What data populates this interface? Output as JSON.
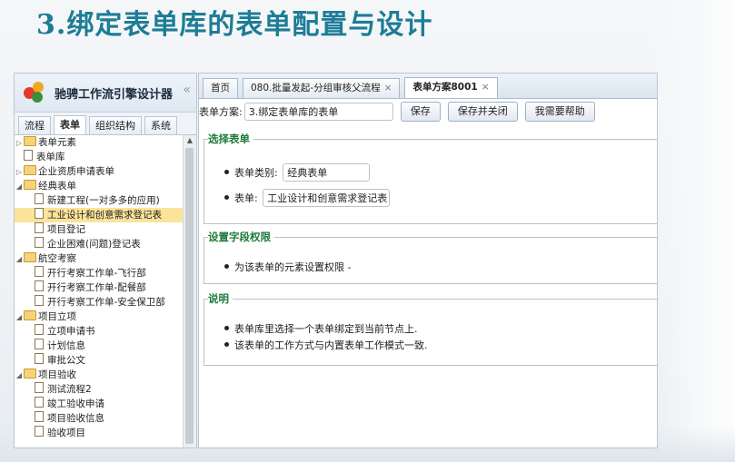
{
  "slide_title": "3.绑定表单库的表单配置与设计",
  "app": {
    "name": "驰骋工作流引擎设计器",
    "collapse_glyph": "«"
  },
  "left_tabs": [
    "流程",
    "表单",
    "组织结构",
    "系统"
  ],
  "tree": [
    {
      "label": "表单元素",
      "type": "folder",
      "level": 0,
      "expand": "▷"
    },
    {
      "label": "表单库",
      "type": "doc",
      "level": 0
    },
    {
      "label": "企业资质申请表单",
      "type": "folder",
      "level": 0,
      "expand": "▷"
    },
    {
      "label": "经典表单",
      "type": "folder",
      "level": 0,
      "expand": "◢"
    },
    {
      "label": "新建工程(一对多多的应用)",
      "type": "doc",
      "level": 1
    },
    {
      "label": "工业设计和创意需求登记表",
      "type": "doc",
      "level": 1,
      "selected": true
    },
    {
      "label": "项目登记",
      "type": "doc",
      "level": 1
    },
    {
      "label": "企业困难(问题)登记表",
      "type": "doc",
      "level": 1
    },
    {
      "label": "航空考察",
      "type": "folder",
      "level": 0,
      "expand": "◢"
    },
    {
      "label": "开行考察工作单-飞行部",
      "type": "doc",
      "level": 1
    },
    {
      "label": "开行考察工作单-配餐部",
      "type": "doc",
      "level": 1
    },
    {
      "label": "开行考察工作单-安全保卫部",
      "type": "doc",
      "level": 1
    },
    {
      "label": "项目立项",
      "type": "folder",
      "level": 0,
      "expand": "◢"
    },
    {
      "label": "立项申请书",
      "type": "doc",
      "level": 1
    },
    {
      "label": "计划信息",
      "type": "doc",
      "level": 1
    },
    {
      "label": "审批公文",
      "type": "doc",
      "level": 1
    },
    {
      "label": "项目验收",
      "type": "folder",
      "level": 0,
      "expand": "◢"
    },
    {
      "label": "测试流程2",
      "type": "doc",
      "level": 1
    },
    {
      "label": "竣工验收申请",
      "type": "doc",
      "level": 1
    },
    {
      "label": "项目验收信息",
      "type": "doc",
      "level": 1
    },
    {
      "label": "验收项目",
      "type": "doc",
      "level": 1
    }
  ],
  "right_tabs": {
    "home": "首页",
    "flow": "080.批量发起-分组审核父流程",
    "scheme": "表单方案8001",
    "close_glyph": "×"
  },
  "form": {
    "scheme_label": "表单方案:",
    "scheme_value": "3.绑定表单库的表单",
    "save": "保存",
    "save_close": "保存并关闭",
    "help": "我需要帮助"
  },
  "select_section": {
    "title": "选择表单",
    "category_label": "表单类别:",
    "category_value": "经典表单",
    "form_label": "表单:",
    "form_value": "工业设计和创意需求登记表"
  },
  "perm_section": {
    "title": "设置字段权限",
    "item": "为该表单的元素设置权限 -"
  },
  "desc_section": {
    "title": "说明",
    "items": [
      "表单库里选择一个表单绑定到当前节点上.",
      "该表单的工作方式与内置表单工作模式一致."
    ]
  },
  "colors": {
    "title": "#1d7c96",
    "legend": "#1d7a3a",
    "selected_row": "#fbe49a"
  }
}
